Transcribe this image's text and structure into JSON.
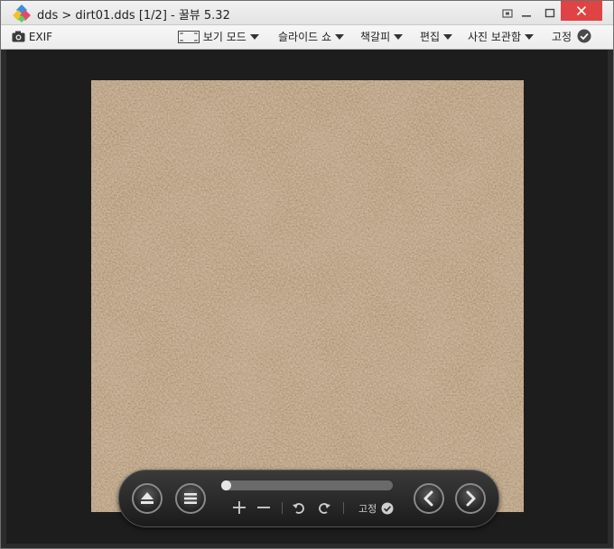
{
  "window": {
    "title": "dds > dirt01.dds [1/2] - 꿀뷰 5.32",
    "minimize_icon": "minimize-icon",
    "maximize_icon": "maximize-icon",
    "close_icon": "close-icon",
    "close_color": "#e04343"
  },
  "toolbar": {
    "exif_label": "EXIF",
    "view_mode_label": "보기 모드",
    "slideshow_label": "슬라이드 쇼",
    "bookmark_label": "책갈피",
    "edit_label": "편집",
    "photo_archive_label": "사진 보관함",
    "pin_label": "고정"
  },
  "image": {
    "description_icon": "dirt-texture-image",
    "base_color": "#8a6a4c"
  },
  "controls": {
    "progress_fraction": 0.0,
    "pin_label": "고정",
    "icons": [
      "eject-icon",
      "menu-icon",
      "zoom-in-icon",
      "zoom-out-icon",
      "rotate-left-icon",
      "rotate-right-icon",
      "check-icon",
      "prev-icon",
      "next-icon"
    ]
  }
}
